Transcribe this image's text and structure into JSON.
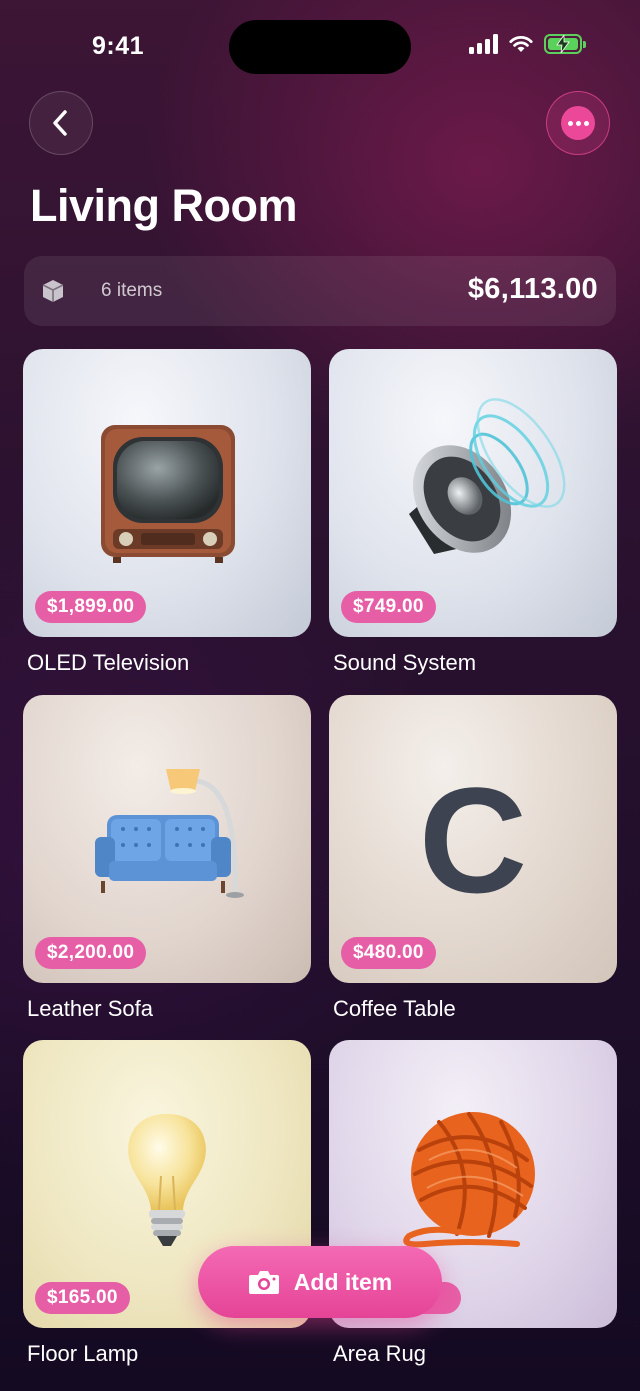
{
  "status_bar": {
    "time": "9:41"
  },
  "header": {
    "title": "Living Room"
  },
  "summary": {
    "item_count": "6 items",
    "total_value": "$6,113.00"
  },
  "items": [
    {
      "name": "OLED Television",
      "price": "$1,899.00",
      "icon": "television-icon"
    },
    {
      "name": "Sound System",
      "price": "$749.00",
      "icon": "speaker-icon"
    },
    {
      "name": "Leather Sofa",
      "price": "$2,200.00",
      "icon": "sofa-lamp-icon"
    },
    {
      "name": "Coffee Table",
      "price": "$480.00",
      "icon": "letter-c-placeholder",
      "glyph": "C"
    },
    {
      "name": "Floor Lamp",
      "price": "$165.00",
      "icon": "light-bulb-icon"
    },
    {
      "name": "Area Rug",
      "price": "",
      "icon": "yarn-ball-icon"
    }
  ],
  "fab": {
    "label": "Add item",
    "icon": "camera-icon"
  },
  "colors": {
    "accent": "#ec4899",
    "badge": "#e65fa6",
    "battery": "#5ad15a"
  }
}
